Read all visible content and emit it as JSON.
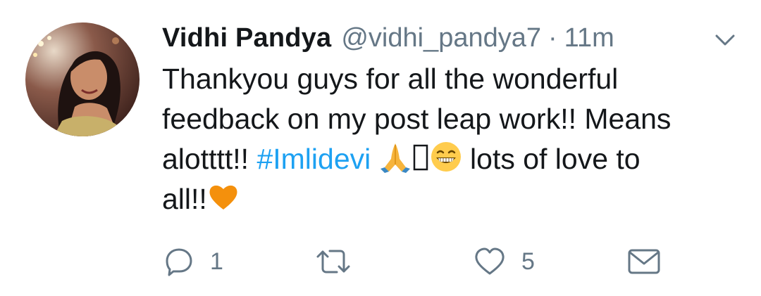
{
  "tweet": {
    "author_name": "Vidhi Pandya",
    "author_handle": "@vidhi_pandya7",
    "separator": "·",
    "time": "11m",
    "text": {
      "line1": "Thankyou guys for all the wonderful",
      "line2": "feedback on my post leap work!! Means",
      "line3_pre": "alotttt!! ",
      "hashtag": "#Imlidevi",
      "line3_post": " lots of love to",
      "line4": "all!!"
    },
    "emojis": [
      "folded-hands-emoji",
      "missing-glyph",
      "grinning-face-emoji",
      "orange-heart-emoji"
    ],
    "actions": {
      "reply_count": "1",
      "retweet_count": "",
      "like_count": "5"
    }
  },
  "colors": {
    "text": "#14171a",
    "secondary": "#657786",
    "link": "#1da1f2",
    "icon": "#657786"
  }
}
